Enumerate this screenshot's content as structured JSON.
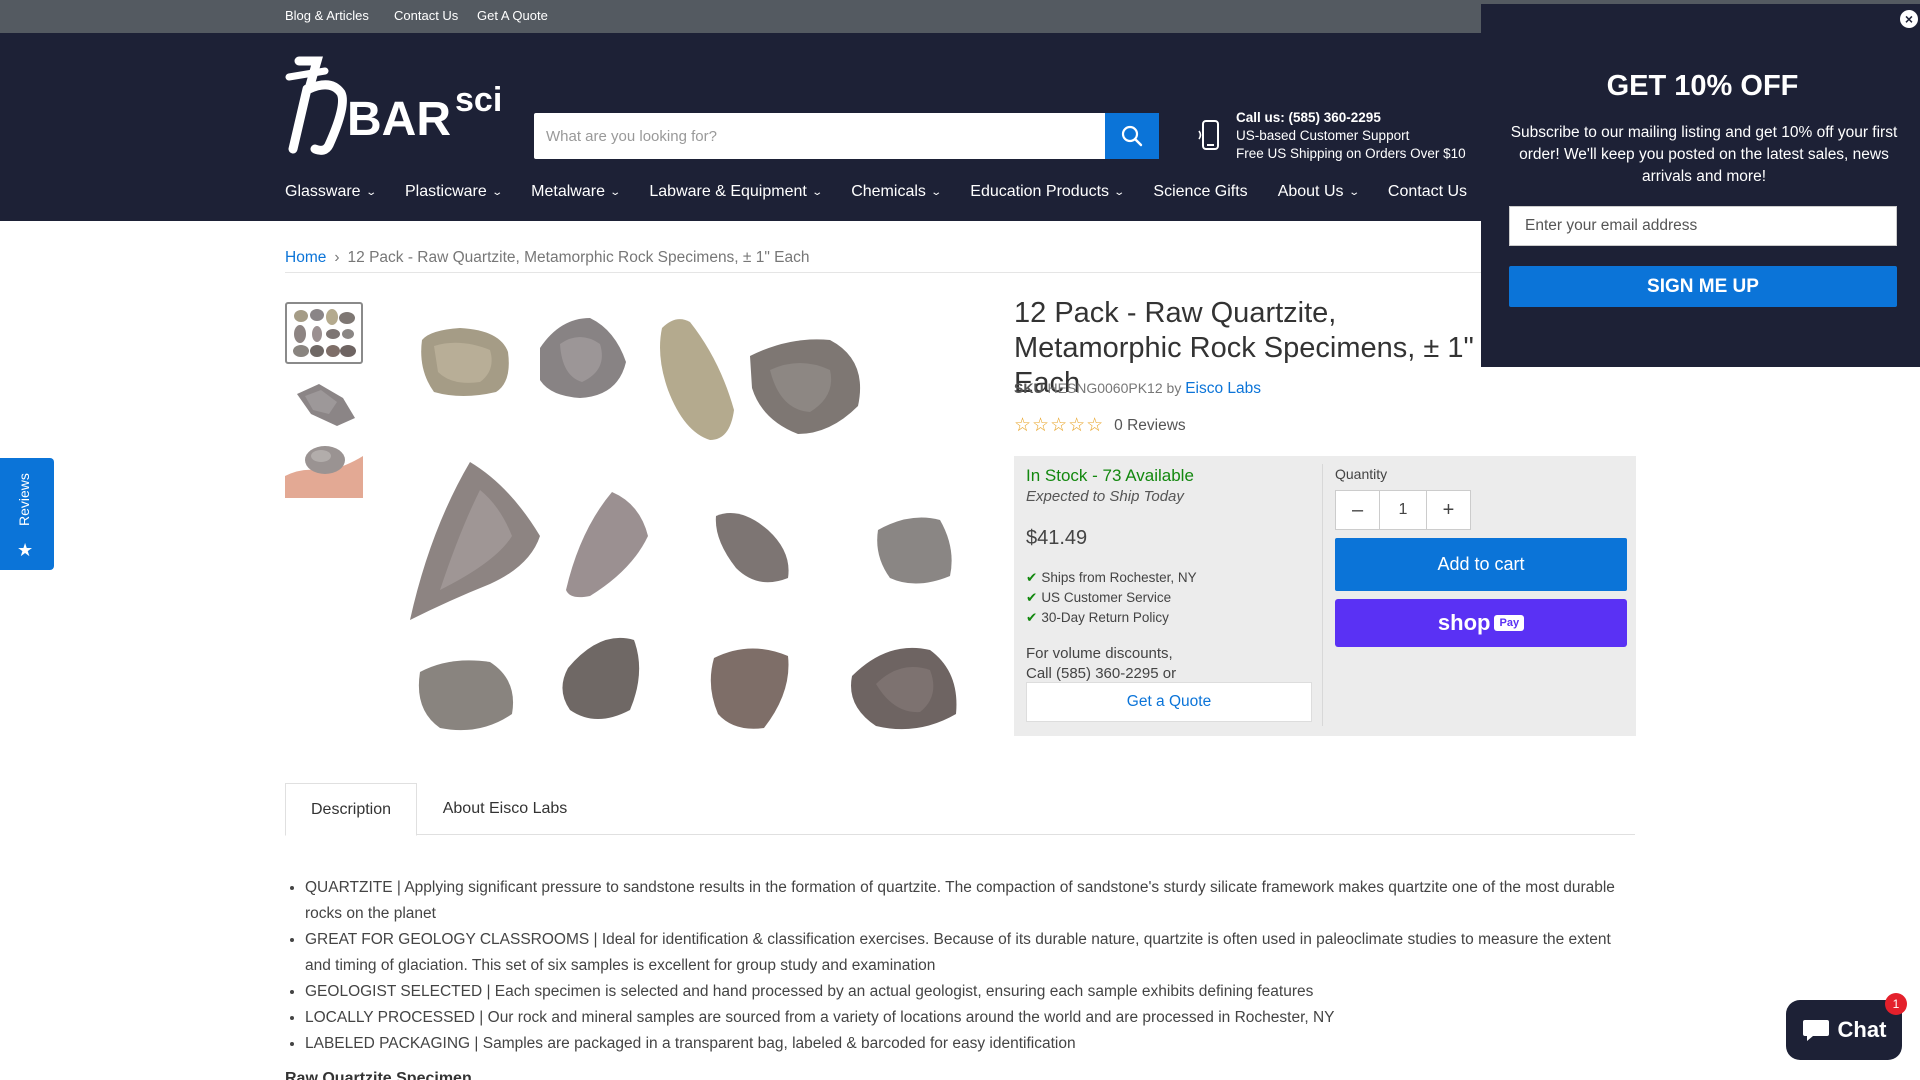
{
  "utility_nav": [
    "Blog & Articles",
    "Contact Us",
    "Get A Quote"
  ],
  "search": {
    "placeholder": "What are you looking for?"
  },
  "contact": {
    "phone_line": "Call us: (585) 360-2295",
    "support_line": "US-based Customer Support",
    "shipping_line": "Free US Shipping on Orders Over $10"
  },
  "main_nav": [
    {
      "label": "Glassware",
      "has_dropdown": true
    },
    {
      "label": "Plasticware",
      "has_dropdown": true
    },
    {
      "label": "Metalware",
      "has_dropdown": true
    },
    {
      "label": "Labware & Equipment",
      "has_dropdown": true
    },
    {
      "label": "Chemicals",
      "has_dropdown": true
    },
    {
      "label": "Education Products",
      "has_dropdown": true
    },
    {
      "label": "Science Gifts",
      "has_dropdown": false
    },
    {
      "label": "About Us",
      "has_dropdown": true
    },
    {
      "label": "Contact Us",
      "has_dropdown": false
    }
  ],
  "breadcrumb": {
    "home": "Home",
    "separator": "›",
    "current": "12 Pack - Raw Quartzite, Metamorphic Rock Specimens, ± 1\" Each"
  },
  "product": {
    "title": "12 Pack - Raw Quartzite, Metamorphic Rock Specimens, ± 1\" Each",
    "sku_label": "SKU",
    "sku": "HESNG0060PK12",
    "by": "by",
    "vendor": "Eisco Labs",
    "stars": "☆☆☆☆☆",
    "reviews_count": "0 Reviews",
    "stock": "In Stock - 73 Available",
    "ship_note": "Expected to Ship Today",
    "price": "$41.49",
    "features": [
      "Ships from Rochester, NY",
      "US Customer Service",
      "30-Day Return Policy"
    ],
    "volume_line1": "For volume discounts,",
    "volume_line2": "Call (585) 360-2295 or",
    "quote_button": "Get a Quote",
    "quantity_label": "Quantity",
    "quantity_value": "1",
    "add_to_cart": "Add to cart",
    "shop_pay_label": "shop",
    "shop_pay_badge": "Pay"
  },
  "tabs": [
    "Description",
    "About Eisco Labs"
  ],
  "description": [
    "QUARTZITE | Applying significant pressure to sandstone results in the formation of quartzite. The compaction of sandstone's sturdy silicate framework makes quartzite one of the most durable rocks on the planet",
    "GREAT FOR GEOLOGY CLASSROOMS | Ideal for identification & classification exercises. Because of its durable nature, quartzite is often used in paleoclimate studies to measure the extent and timing of glaciation. This set of six samples is excellent for group study and examination",
    "GEOLOGIST SELECTED | Each specimen is selected and hand processed by an actual geologist, ensuring each sample exhibits defining features",
    "LOCALLY PROCESSED | Our rock and mineral samples are sourced from a variety of locations around the world and are processed in Rochester, NY",
    "LABELED PACKAGING | Samples are packaged in a transparent bag, labeled & barcoded for easy identification"
  ],
  "description_subtitle": "Raw Quartzite Specimen",
  "reviews_tab": "Reviews",
  "popup": {
    "title": "GET 10% OFF",
    "body": "Subscribe to our mailing listing and get 10% off your first order! We'll keep you posted on the latest sales, news arrivals and more!",
    "email_placeholder": "Enter your email address",
    "button": "SIGN ME UP",
    "close": "×"
  },
  "chat": {
    "label": "Chat",
    "badge": "1"
  },
  "colors": {
    "header": "#1d2136",
    "accent": "#0b74d8",
    "stock": "#13880f",
    "shop_pay": "#5a31f4"
  }
}
